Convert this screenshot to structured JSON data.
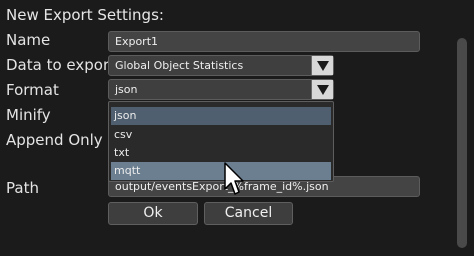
{
  "dialog": {
    "heading": "New Export Settings:"
  },
  "labels": {
    "name": "Name",
    "data_to_export": "Data to export",
    "format": "Format",
    "minify": "Minify",
    "append_only": "Append Only",
    "path": "Path"
  },
  "fields": {
    "name_value": "Export1",
    "data_to_export_value": "Global Object Statistics",
    "format_value": "json",
    "path_value": "output/eventsExport_%frame_id%.json"
  },
  "format_options": [
    "json",
    "csv",
    "txt",
    "mqtt"
  ],
  "format_selected": "json",
  "format_hovered": "mqtt",
  "buttons": {
    "ok": "Ok",
    "cancel": "Cancel"
  },
  "icons": {
    "dropdown_arrow": "triangle-down-icon",
    "cursor": "mouse-pointer-icon"
  },
  "colors": {
    "background": "#1b1b1b",
    "field": "#444444",
    "selected_option": "#4f5f6f",
    "hovered_option": "#6b7f91"
  }
}
